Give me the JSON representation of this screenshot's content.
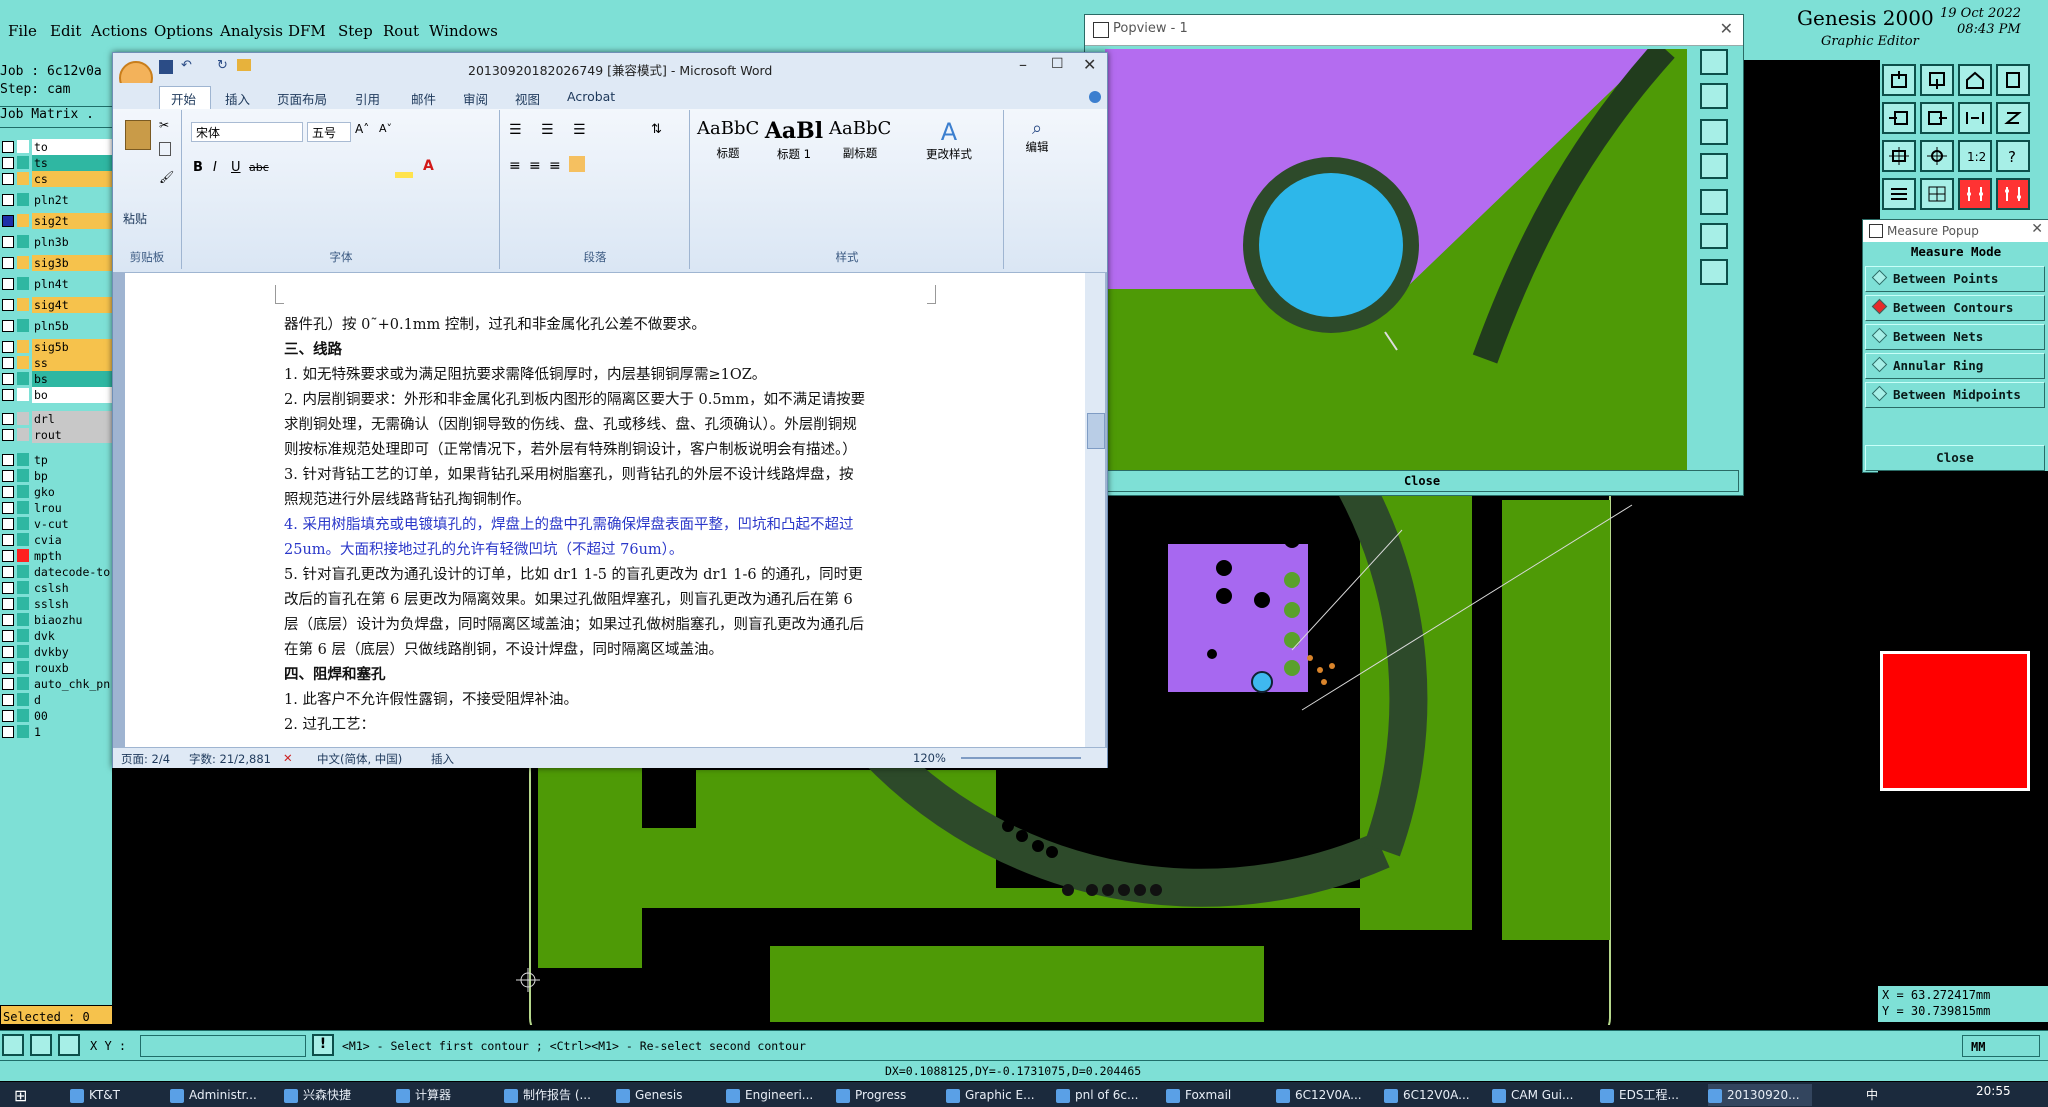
{
  "genesis": {
    "menu": [
      "File",
      "Edit",
      "Actions",
      "Options",
      "Analysis",
      "DFM",
      "Step",
      "Rout",
      "Windows"
    ],
    "logo_prefix": "line",
    "brand": "Genesis 2000",
    "brand_sub": "Graphic Editor",
    "date": "19 Oct 2022",
    "time": "08:43 PM",
    "job": "Job : 6c12v0a",
    "step": "Step: cam",
    "job_matrix": "Job Matrix .",
    "selected": "Selected : 0",
    "xy_label": "X Y :",
    "xy_value": "",
    "prompt": "<M1> - Select first contour ; <Ctrl><M1> - Re-select second contour",
    "units": "MM",
    "status": "DX=0.1088125,DY=-0.1731075,D=0.204465",
    "coord_x": "X  =  63.272417mm",
    "coord_y": "Y  =  30.739815mm",
    "layers": [
      {
        "name": "to",
        "color": "#ffffff"
      },
      {
        "name": "ts",
        "color": "#2fb7a2"
      },
      {
        "name": "cs",
        "color": "#f6c24c"
      },
      {
        "name": "pln2t",
        "color": "#7ee0d6"
      },
      {
        "name": "sig2t",
        "color": "#f6c24c"
      },
      {
        "name": "pln3b",
        "color": "#7ee0d6"
      },
      {
        "name": "sig3b",
        "color": "#f6c24c"
      },
      {
        "name": "pln4t",
        "color": "#7ee0d6"
      },
      {
        "name": "sig4t",
        "color": "#f6c24c"
      },
      {
        "name": "pln5b",
        "color": "#7ee0d6"
      },
      {
        "name": "sig5b",
        "color": "#f6c24c"
      },
      {
        "name": "ss",
        "color": "#f6c24c"
      },
      {
        "name": "bs",
        "color": "#2fb7a2"
      },
      {
        "name": "bo",
        "color": "#ffffff"
      },
      {
        "name": "drl",
        "color": "#c8c8c8"
      },
      {
        "name": "rout",
        "color": "#c8c8c8"
      },
      {
        "name": "tp",
        "color": "#7ee0d6"
      },
      {
        "name": "bp",
        "color": "#7ee0d6"
      },
      {
        "name": "gko",
        "color": "#7ee0d6"
      },
      {
        "name": "lrou",
        "color": "#7ee0d6"
      },
      {
        "name": "v-cut",
        "color": "#7ee0d6"
      },
      {
        "name": "cvia",
        "color": "#7ee0d6"
      },
      {
        "name": "mpth",
        "color": "#7ee0d6"
      },
      {
        "name": "datecode-to",
        "color": "#7ee0d6"
      },
      {
        "name": "cslsh",
        "color": "#7ee0d6"
      },
      {
        "name": "sslsh",
        "color": "#7ee0d6"
      },
      {
        "name": "biaozhu",
        "color": "#7ee0d6"
      },
      {
        "name": "dvk",
        "color": "#7ee0d6"
      },
      {
        "name": "dvkby",
        "color": "#7ee0d6"
      },
      {
        "name": "rouxb",
        "color": "#7ee0d6"
      },
      {
        "name": "auto_chk_pn",
        "color": "#7ee0d6"
      },
      {
        "name": "d",
        "color": "#7ee0d6"
      },
      {
        "name": "00",
        "color": "#7ee0d6"
      },
      {
        "name": "1",
        "color": "#7ee0d6"
      }
    ],
    "popview_title": "Popview - 1",
    "popview_close": "Close",
    "measure_title": "Measure Popup",
    "measure_mode": "Measure Mode",
    "measure_options": [
      "Between Points",
      "Between Contours",
      "Between Nets",
      "Annular Ring",
      "Between Midpoints"
    ],
    "measure_selected": "Between Contours",
    "measure_close": "Close"
  },
  "word": {
    "title": "20130920182026749 [兼容模式] - Microsoft Word",
    "tabs": [
      "开始",
      "插入",
      "页面布局",
      "引用",
      "邮件",
      "审阅",
      "视图",
      "Acrobat"
    ],
    "active_tab": "开始",
    "font_name": "宋体",
    "font_size": "五号",
    "groups": [
      "剪贴板",
      "字体",
      "段落",
      "样式",
      "编辑"
    ],
    "paste": "粘贴",
    "styles": [
      {
        "preview": "AaBbC",
        "label": "标题"
      },
      {
        "preview": "AaBl",
        "label": "标题 1"
      },
      {
        "preview": "AaBbC",
        "label": "副标题"
      }
    ],
    "change_styles": "更改样式",
    "edit": "编辑",
    "status": {
      "page": "页面: 2/4",
      "words": "字数: 21/2,881",
      "lang": "中文(简体, 中国)",
      "mode": "插入",
      "zoom": "120%"
    },
    "lines": [
      "器件孔）按 0˜+0.1mm 控制，过孔和非金属化孔公差不做要求。",
      "三、线路",
      "1. 如无特殊要求或为满足阻抗要求需降低铜厚时，内层基铜铜厚需≥1OZ。",
      "2. 内层削铜要求：外形和非金属化孔到板内图形的隔离区要大于 0.5mm，如不满足请按要",
      "求削铜处理，无需确认（因削铜导致的伤线、盘、孔或移线、盘、孔须确认）。外层削铜规",
      "则按标准规范处理即可（正常情况下，若外层有特殊削铜设计，客户制板说明会有描述。）",
      "3. 针对背钻工艺的订单，如果背钻孔采用树脂塞孔，则背钻孔的外层不设计线路焊盘，按",
      "照规范进行外层线路背钻孔掏铜制作。",
      "4. 采用树脂填充或电镀填孔的，焊盘上的盘中孔需确保焊盘表面平整，凹坑和凸起不超过",
      "25um。大面积接地过孔的允许有轻微凹坑（不超过 76um）。",
      "5. 针对盲孔更改为通孔设计的订单，比如 dr1 1-5 的盲孔更改为 dr1 1-6 的通孔，同时更",
      "改后的盲孔在第 6 层更改为隔离效果。如果过孔做阻焊塞孔，则盲孔更改为通孔后在第 6",
      "层（底层）设计为负焊盘，同时隔离区域盖油；如果过孔做树脂塞孔，则盲孔更改为通孔后",
      "在第 6 层（底层）只做线路削铜，不设计焊盘，同时隔离区域盖油。",
      "四、阻焊和塞孔",
      "1. 此客户不允许假性露铜，不接受阻焊补油。",
      "2. 过孔工艺："
    ]
  },
  "taskbar": {
    "items": [
      "KT&T",
      "Administr...",
      "兴森快捷",
      "计算器",
      "制作报告 (...",
      "Genesis",
      "Engineeri...",
      "Progress",
      "Graphic E...",
      "pnl of 6c...",
      "Foxmail",
      "6C12V0A...",
      "6C12V0A...",
      "CAM Gui...",
      "EDS工程...",
      "20130920..."
    ],
    "time": "20:55",
    "ime": "中"
  }
}
